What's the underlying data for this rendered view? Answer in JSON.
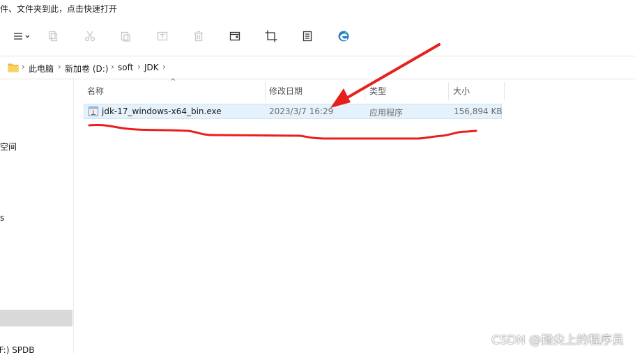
{
  "hint_text": "件、文件夹到此，点击快速打开",
  "toolbar": {
    "buttons": [
      {
        "name": "view-menu-button",
        "icon": "menu-lines-icon"
      },
      {
        "name": "copy-button",
        "icon": "copy-icon"
      },
      {
        "name": "cut-button",
        "icon": "scissors-icon"
      },
      {
        "name": "paste-button",
        "icon": "paste-icon"
      },
      {
        "name": "rename-button",
        "icon": "rename-icon"
      },
      {
        "name": "delete-button",
        "icon": "trash-icon"
      },
      {
        "name": "new-window-button",
        "icon": "window-icon"
      },
      {
        "name": "crop-button",
        "icon": "crop-icon"
      },
      {
        "name": "properties-button",
        "icon": "properties-icon"
      },
      {
        "name": "edge-button",
        "icon": "edge-icon"
      }
    ]
  },
  "address_bar": {
    "breadcrumbs": [
      "此电脑",
      "新加卷 (D:)",
      "soft",
      "JDK"
    ]
  },
  "nav_pane": {
    "items": [
      "空间",
      "s",
      "(F:) SPDB"
    ]
  },
  "columns": {
    "name": "名称",
    "modified": "修改日期",
    "type": "类型",
    "size": "大小"
  },
  "files": [
    {
      "name": "jdk-17_windows-x64_bin.exe",
      "modified": "2023/3/7 16:29",
      "type": "应用程序",
      "size": "156,894 KB"
    }
  ],
  "watermark": "CSDN @指尖上的程序员",
  "colors": {
    "annotation": "#e8201d",
    "selection": "#e5f1fb"
  }
}
